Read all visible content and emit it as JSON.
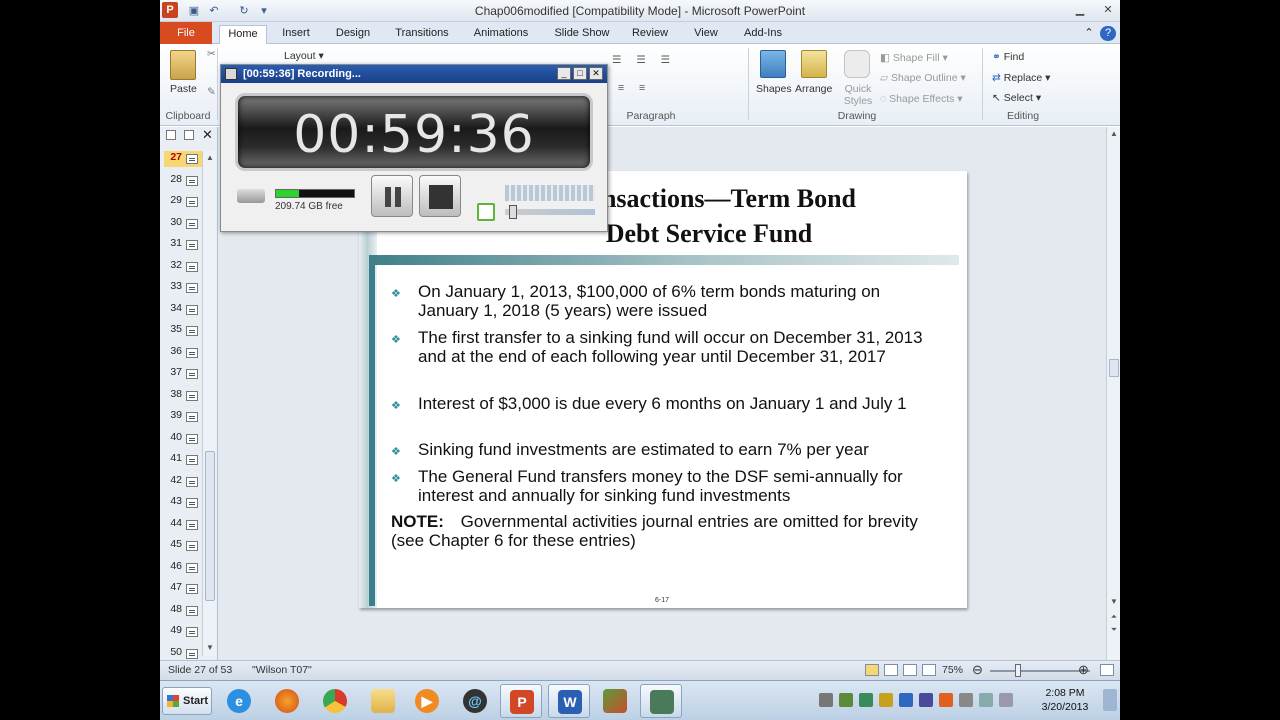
{
  "window": {
    "title": "Chap006modified [Compatibility Mode]  -  Microsoft PowerPoint",
    "app_icon": "P"
  },
  "ribbon_tabs": [
    "File",
    "Home",
    "Insert",
    "Design",
    "Transitions",
    "Animations",
    "Slide Show",
    "Review",
    "View",
    "Add-Ins"
  ],
  "ribbon": {
    "paste": "Paste",
    "layout": "Layout",
    "clipboard": "Clipboard",
    "paragraph": "Paragraph",
    "drawing": "Drawing",
    "editing": "Editing",
    "shapes": "Shapes",
    "arrange": "Arrange",
    "quick_styles": "Quick Styles",
    "shape_fill": "Shape Fill",
    "shape_outline": "Shape Outline",
    "shape_effects": "Shape Effects",
    "find": "Find",
    "replace": "Replace",
    "select": "Select"
  },
  "slide_panel": {
    "numbers": [
      "27",
      "28",
      "29",
      "30",
      "31",
      "32",
      "33",
      "34",
      "35",
      "36",
      "37",
      "38",
      "39",
      "40",
      "41",
      "42",
      "43",
      "44",
      "45",
      "46",
      "47",
      "48",
      "49",
      "50"
    ],
    "selected": "27"
  },
  "slide": {
    "title_line1": "Transactions—Term Bond",
    "title_line2": "Debt Service Fund",
    "bullets": [
      "On January 1, 2013, $100,000 of 6% term bonds maturing on January 1, 2018 (5 years) were issued",
      "The first transfer to a sinking fund will occur on December 31, 2013 and at the end of each following year until December 31, 2017",
      "Interest of $3,000 is due every 6 months on January 1 and July 1",
      "Sinking fund investments are estimated to earn 7% per year",
      "The General Fund transfers money to the DSF semi-annually for interest and annually for sinking fund investments"
    ],
    "note_label": "NOTE:",
    "note_text": "Governmental activities journal entries are omitted for brevity (see Chapter 6 for these entries)",
    "footer_num": "6-17"
  },
  "status": {
    "slide_info": "Slide 27 of 53",
    "theme": "\"Wilson T07\"",
    "zoom": "75%"
  },
  "taskbar": {
    "start": "Start",
    "time": "2:08 PM",
    "date": "3/20/2013"
  },
  "recorder": {
    "title": "[00:59:36] Recording...",
    "time": "00:59:36",
    "disk_free": "209.74 GB free",
    "disk_fill_fraction": 0.3
  },
  "colors": {
    "file_tab": "#d84a20",
    "accent_teal": "#2b8c9a",
    "rec_title": "#2a5db0"
  }
}
